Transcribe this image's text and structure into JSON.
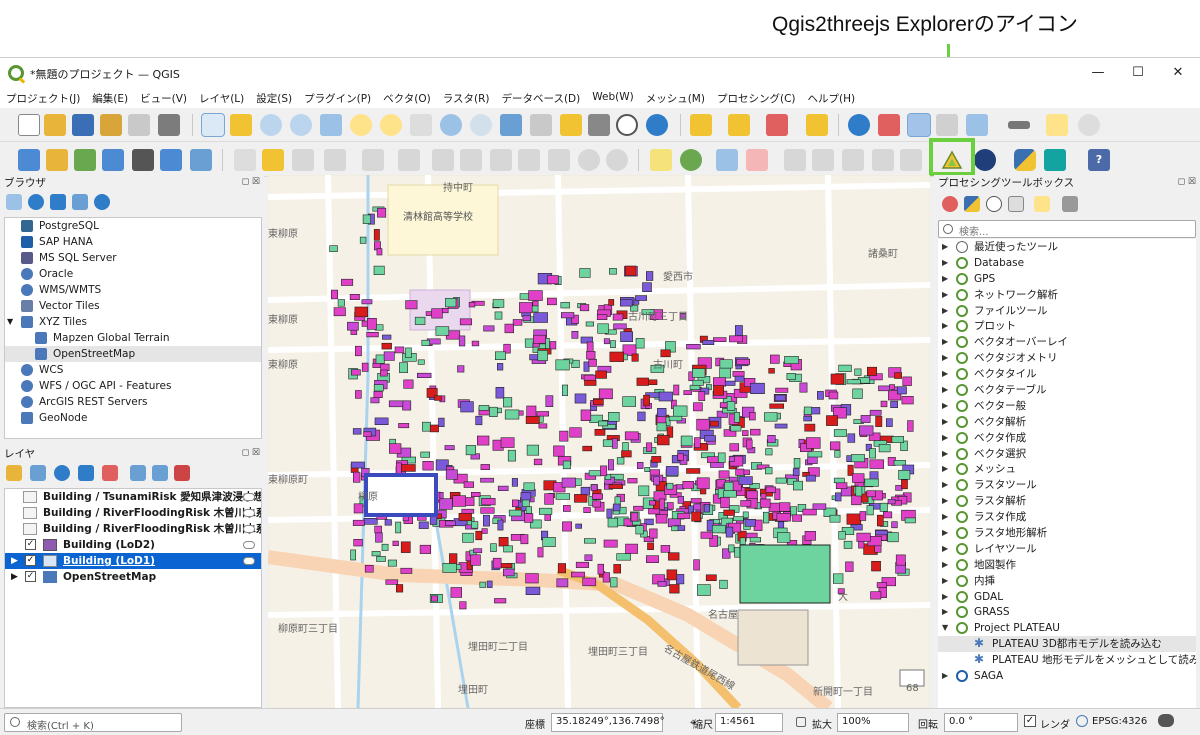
{
  "annotation": {
    "title": "Qgis2threejs Explorerのアイコン"
  },
  "window": {
    "title": "*無題のプロジェクト — QGIS"
  },
  "menu": [
    "プロジェクト(J)",
    "編集(E)",
    "ビュー(V)",
    "レイヤ(L)",
    "設定(S)",
    "プラグイン(P)",
    "ベクタ(O)",
    "ラスタ(R)",
    "データベース(D)",
    "Web(W)",
    "メッシュ(M)",
    "プロセシング(C)",
    "ヘルプ(H)"
  ],
  "browser": {
    "title": "ブラウザ",
    "items": [
      "PostgreSQL",
      "SAP HANA",
      "MS SQL Server",
      "Oracle",
      "WMS/WMTS",
      "Vector Tiles",
      "XYZ Tiles",
      "Mapzen Global Terrain",
      "OpenStreetMap",
      "WCS",
      "WFS / OGC API - Features",
      "ArcGIS REST Servers",
      "GeoNode"
    ]
  },
  "layers": {
    "title": "レイヤ",
    "items": [
      "Building / TsunamiRisk 愛知県津波浸水想定",
      "Building / RiverFloodingRisk 木曽川水系木",
      "Building / RiverFloodingRisk 木曽川水系木",
      "Building (LoD2)",
      "Building (LoD1)",
      "OpenStreetMap"
    ]
  },
  "map": {
    "school": "清林館高等学校",
    "labels": [
      "持中町",
      "愛西市",
      "古川町三丁目",
      "古川町",
      "諸桑町",
      "東柳原",
      "東柳原",
      "東柳原",
      "東柳原町",
      "柳原",
      "柳原町三丁目",
      "埋田町二丁目",
      "埋田町",
      "新開町一丁目",
      "名古屋",
      "埋田町三丁目",
      "名古屋鉄道尾西線",
      "68",
      "大"
    ]
  },
  "processing": {
    "title": "プロセシングツールボックス",
    "search_placeholder": "検索...",
    "items": [
      "最近使ったツール",
      "Database",
      "GPS",
      "ネットワーク解析",
      "ファイルツール",
      "プロット",
      "ベクタオーバーレイ",
      "ベクタジオメトリ",
      "ベクタタイル",
      "ベクタテーブル",
      "ベクター般",
      "ベクタ解析",
      "ベクタ作成",
      "ベクタ選択",
      "メッシュ",
      "ラスタツール",
      "ラスタ解析",
      "ラスタ作成",
      "ラスタ地形解析",
      "レイヤツール",
      "地図製作",
      "内挿",
      "GDAL",
      "GRASS",
      "Project PLATEAU",
      "PLATEAU 3D都市モデルを読み込む",
      "PLATEAU 地形モデルをメッシュとして読み込む",
      "SAGA"
    ]
  },
  "status": {
    "locator_placeholder": "検索(Ctrl + K)",
    "coord_label": "座標",
    "coord_value": "35.18249°,136.7498°",
    "scale_label": "縮尺",
    "scale_value": "1:4561",
    "zoom_label": "拡大",
    "zoom_value": "100%",
    "rotation_label": "回転",
    "rotation_value": "0.0 °",
    "render_label": "レンダ",
    "crs": "EPSG:4326"
  }
}
